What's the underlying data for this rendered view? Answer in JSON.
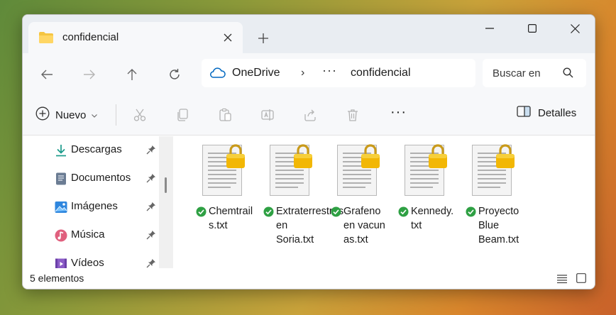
{
  "tab": {
    "title": "confidencial"
  },
  "address": {
    "location": "OneDrive",
    "separator": "›",
    "ellipsis": "···",
    "folder": "confidencial"
  },
  "search": {
    "placeholder": "Buscar en"
  },
  "toolbar": {
    "new_label": "Nuevo",
    "more": "···",
    "details_label": "Detalles"
  },
  "sidebar": {
    "items": [
      {
        "label": "Descargas",
        "icon": "download-icon"
      },
      {
        "label": "Documentos",
        "icon": "documents-icon"
      },
      {
        "label": "Imágenes",
        "icon": "pictures-icon"
      },
      {
        "label": "Música",
        "icon": "music-icon"
      },
      {
        "label": "Vídeos",
        "icon": "videos-icon"
      }
    ]
  },
  "files": [
    {
      "name": "Chemtrails.txt",
      "status": "synced"
    },
    {
      "name": "Extraterrestres en Soria.txt",
      "status": "synced"
    },
    {
      "name": "Grafeno en vacunas.txt",
      "status": "synced"
    },
    {
      "name": "Kennedy.txt",
      "status": "synced"
    },
    {
      "name": "Proyecto Blue Beam.txt",
      "status": "synced"
    }
  ],
  "status": {
    "count": "5 elementos"
  },
  "colors": {
    "accent": "#0067c0",
    "folder": "#f5c542",
    "lock": "#f2b705",
    "synced": "#2ea043"
  }
}
